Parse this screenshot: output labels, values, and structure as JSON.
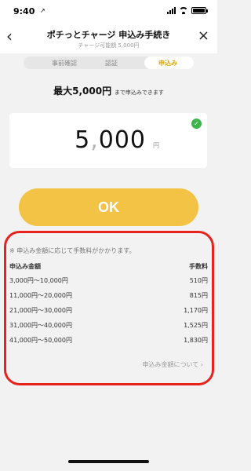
{
  "status_bar": {
    "time": "9:40",
    "location_arrow": "↗"
  },
  "header": {
    "back_label": "‹",
    "close_label": "×",
    "title": "ポチっとチャージ 申込み手続き",
    "subtitle": "チャージ可能額 5,000円"
  },
  "steps": [
    {
      "label": "事前確認",
      "active": false
    },
    {
      "label": "認証",
      "active": false
    },
    {
      "label": "申込み",
      "active": true
    }
  ],
  "limit": {
    "prefix": "最大",
    "amount": "5,000円",
    "suffix": "まで申込みできます"
  },
  "amount_input": {
    "thousands": "5",
    "separator": ",",
    "rest": "000",
    "unit": "円",
    "valid_icon": "check-circle-icon"
  },
  "ok_button": {
    "label": "OK"
  },
  "fee_info": {
    "note": "※ 申込み金額に応じて手数料がかかります。",
    "column_amount": "申込み金額",
    "column_fee": "手数料",
    "rows": [
      {
        "range": "3,000円〜10,000円",
        "fee": "510円"
      },
      {
        "range": "11,000円〜20,000円",
        "fee": "815円"
      },
      {
        "range": "21,000円〜30,000円",
        "fee": "1,170円"
      },
      {
        "range": "31,000円〜40,000円",
        "fee": "1,525円"
      },
      {
        "range": "41,000円〜50,000円",
        "fee": "1,830円"
      }
    ],
    "more_link": "申込み金額について ›"
  },
  "colors": {
    "accent": "#f2c344",
    "active_step": "#d9a400",
    "highlight": "#e8231c",
    "check": "#3db54a",
    "background": "#f2f2f2"
  }
}
